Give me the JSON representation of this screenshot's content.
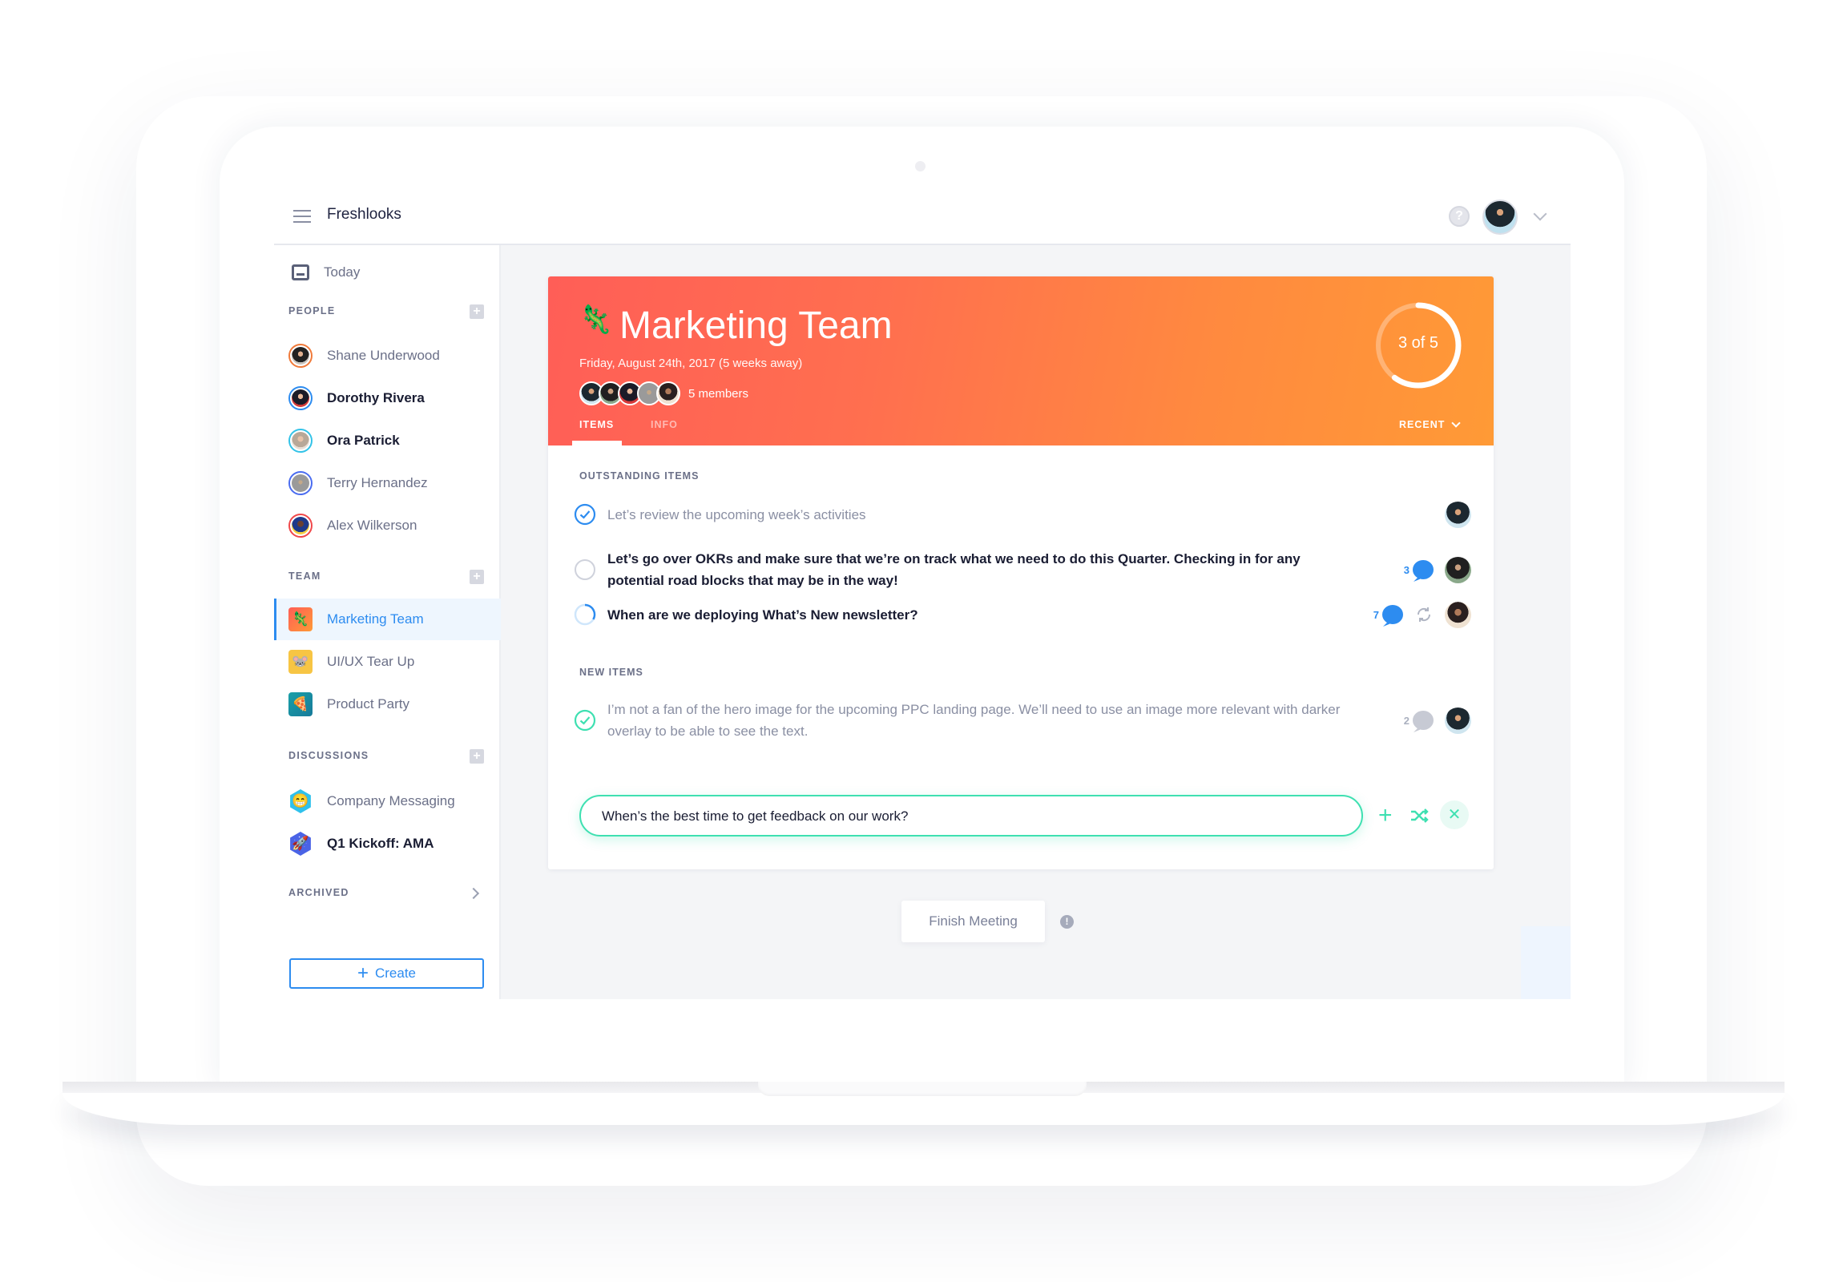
{
  "app": {
    "title": "Freshlooks",
    "help_icon": "question-circle-icon",
    "user_menu_icon": "chevron-down-icon"
  },
  "sidebar": {
    "today_label": "Today",
    "people_label": "PEOPLE",
    "people": [
      {
        "name": "Shane Underwood",
        "bold": false,
        "ring": "#f07a3a"
      },
      {
        "name": "Dorothy Rivera",
        "bold": true,
        "ring": "#2d8cf0"
      },
      {
        "name": "Ora Patrick",
        "bold": true,
        "ring": "#33c3e8"
      },
      {
        "name": "Terry Hernandez",
        "bold": false,
        "ring": "#4a6cf0"
      },
      {
        "name": "Alex Wilkerson",
        "bold": false,
        "ring": "#f0484a"
      }
    ],
    "team_label": "TEAM",
    "teams": [
      {
        "name": "Marketing Team",
        "icon": "🦎",
        "active": true,
        "color": "#ff6a4a"
      },
      {
        "name": "UI/UX Tear Up",
        "icon": "🐭",
        "active": false,
        "color": "#f7c544"
      },
      {
        "name": "Product Party",
        "icon": "🍕",
        "active": false,
        "color": "#1aa0a8"
      }
    ],
    "discussions_label": "DISCUSSIONS",
    "discussions": [
      {
        "name": "Company Messaging",
        "icon": "😁",
        "bold": false,
        "color": "#2fc1ec"
      },
      {
        "name": "Q1 Kickoff: AMA",
        "icon": "🚀",
        "bold": true,
        "color": "#4a63e6"
      }
    ],
    "archived_label": "ARCHIVED",
    "create_label": "Create",
    "accent": "#2d8cf0"
  },
  "meeting": {
    "title": "Marketing Team",
    "icon": "🦎",
    "date": "Friday, August 24th, 2017 (5 weeks away)",
    "members_count": "5 members",
    "progress": {
      "completed": 3,
      "total": 5,
      "label": "3 of 5"
    },
    "tabs": [
      {
        "label": "ITEMS",
        "active": true
      },
      {
        "label": "INFO",
        "active": false
      }
    ],
    "sort_label": "RECENT",
    "gradient": [
      "#ff5e57",
      "#ff9a36"
    ]
  },
  "outstanding": {
    "label": "OUTSTANDING ITEMS",
    "items": [
      {
        "text": "Let’s review the upcoming week’s activities",
        "status": "done",
        "comments": null
      },
      {
        "text": "Let’s go over OKRs and make sure that we’re on track what we need to do this Quarter. Checking in for any potential road blocks that may be in the way!",
        "status": "open",
        "comments": "3"
      },
      {
        "text": "When are we deploying What’s New newsletter?",
        "status": "in-progress",
        "comments": "7"
      }
    ]
  },
  "new_items": {
    "label": "NEW ITEMS",
    "items": [
      {
        "text": "I’m not a fan of the hero image for the upcoming PPC landing page. We’ll need to use an image more relevant with darker overlay to be able to see the text.",
        "status": "done-new",
        "comments": "2"
      }
    ]
  },
  "compose": {
    "value": "When’s the best time to get feedback on our work?",
    "add_icon": "plus-icon",
    "shuffle_icon": "shuffle-icon",
    "close_icon": "close-icon",
    "accent": "#3ee0b1"
  },
  "finish": {
    "label": "Finish Meeting",
    "info_icon": "exclamation-circle-icon"
  }
}
